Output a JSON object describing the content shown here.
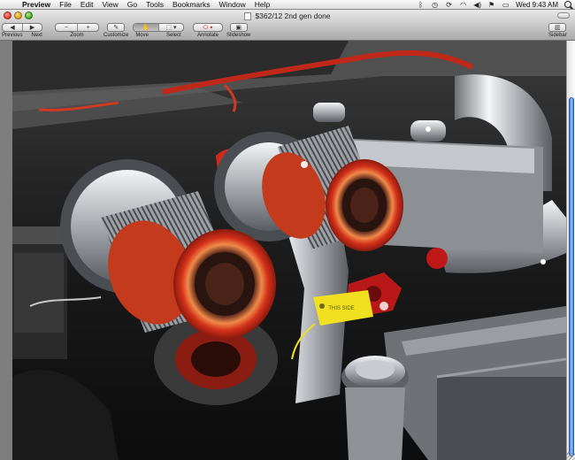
{
  "menubar": {
    "apple_glyph": "",
    "items": [
      "Preview",
      "File",
      "Edit",
      "View",
      "Go",
      "Tools",
      "Bookmarks",
      "Window",
      "Help"
    ],
    "clock": "Wed 9:43 AM",
    "extras": [
      "bluetooth-icon",
      "wifi-icon",
      "volume-icon",
      "flag-icon",
      "battery-icon",
      "time-machine-icon",
      "sync-icon",
      "search-icon"
    ]
  },
  "window": {
    "title": "$362/12 2nd gen done"
  },
  "toolbar": {
    "previous_label": "Previous",
    "next_label": "Next",
    "zoom_label": "Zoom",
    "zoom_out_glyph": "−",
    "zoom_in_glyph": "+",
    "customize_label": "Customize",
    "move_label": "Move",
    "select_label": "Select",
    "annotate_label": "Annotate",
    "slideshow_label": "Slideshow",
    "sidebar_label": "Sidebar"
  },
  "photo": {
    "label_text": "THIS SIDE"
  },
  "colors": {
    "accent_scroll": "#3b7fe6",
    "filter_ring": "#d23018",
    "chrome": "#d9dde0"
  }
}
